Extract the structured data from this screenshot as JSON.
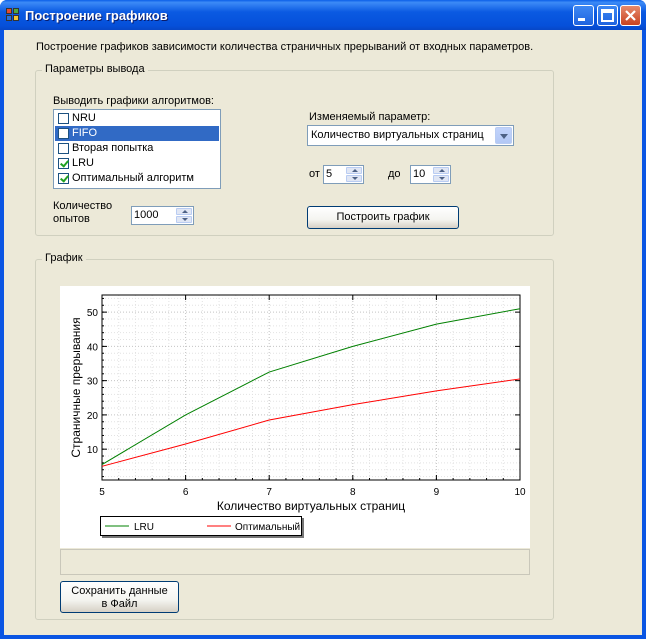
{
  "window": {
    "title": "Построение графиков"
  },
  "intro_text": "Построение графиков зависимости количества страничных прерываний от входных параметров.",
  "output_group": {
    "legend": "Параметры вывода",
    "algorithms_label": "Выводить графики алгоритмов:",
    "algorithms": [
      {
        "label": "NRU",
        "checked": false,
        "selected": false
      },
      {
        "label": "FIFO",
        "checked": false,
        "selected": true
      },
      {
        "label": "Вторая попытка",
        "checked": false,
        "selected": false
      },
      {
        "label": "LRU",
        "checked": true,
        "selected": false
      },
      {
        "label": "Оптимальный алгоритм",
        "checked": true,
        "selected": false
      }
    ],
    "param_label": "Изменяемый параметр:",
    "param_value": "Количество виртуальных страниц",
    "from_label": "от",
    "from_value": "5",
    "to_label": "до",
    "to_value": "10",
    "trials_label_1": "Количество",
    "trials_label_2": "опытов",
    "trials_value": "1000",
    "build_button": "Построить график"
  },
  "graph_group": {
    "legend": "График"
  },
  "save_button_line1": "Сохранить данные",
  "save_button_line2": "в Файл",
  "chart_data": {
    "type": "line",
    "xlabel": "Количество виртуальных страниц",
    "ylabel": "Страничные прерывания",
    "xlim": [
      5,
      10
    ],
    "ylim": [
      1,
      55
    ],
    "xticks": [
      5,
      6,
      7,
      8,
      9,
      10
    ],
    "yticks": [
      10,
      20,
      30,
      40,
      50
    ],
    "grid": true,
    "legend_position": "bottom-left",
    "x": [
      5,
      6,
      7,
      8,
      9,
      10
    ],
    "series": [
      {
        "name": "LRU",
        "color": "#008000",
        "values": [
          5.5,
          20,
          32.5,
          40,
          46.5,
          51
        ]
      },
      {
        "name": "Оптимальный",
        "color": "#FF0000",
        "values": [
          5,
          11.5,
          18.5,
          23,
          27,
          30.5
        ]
      }
    ]
  }
}
